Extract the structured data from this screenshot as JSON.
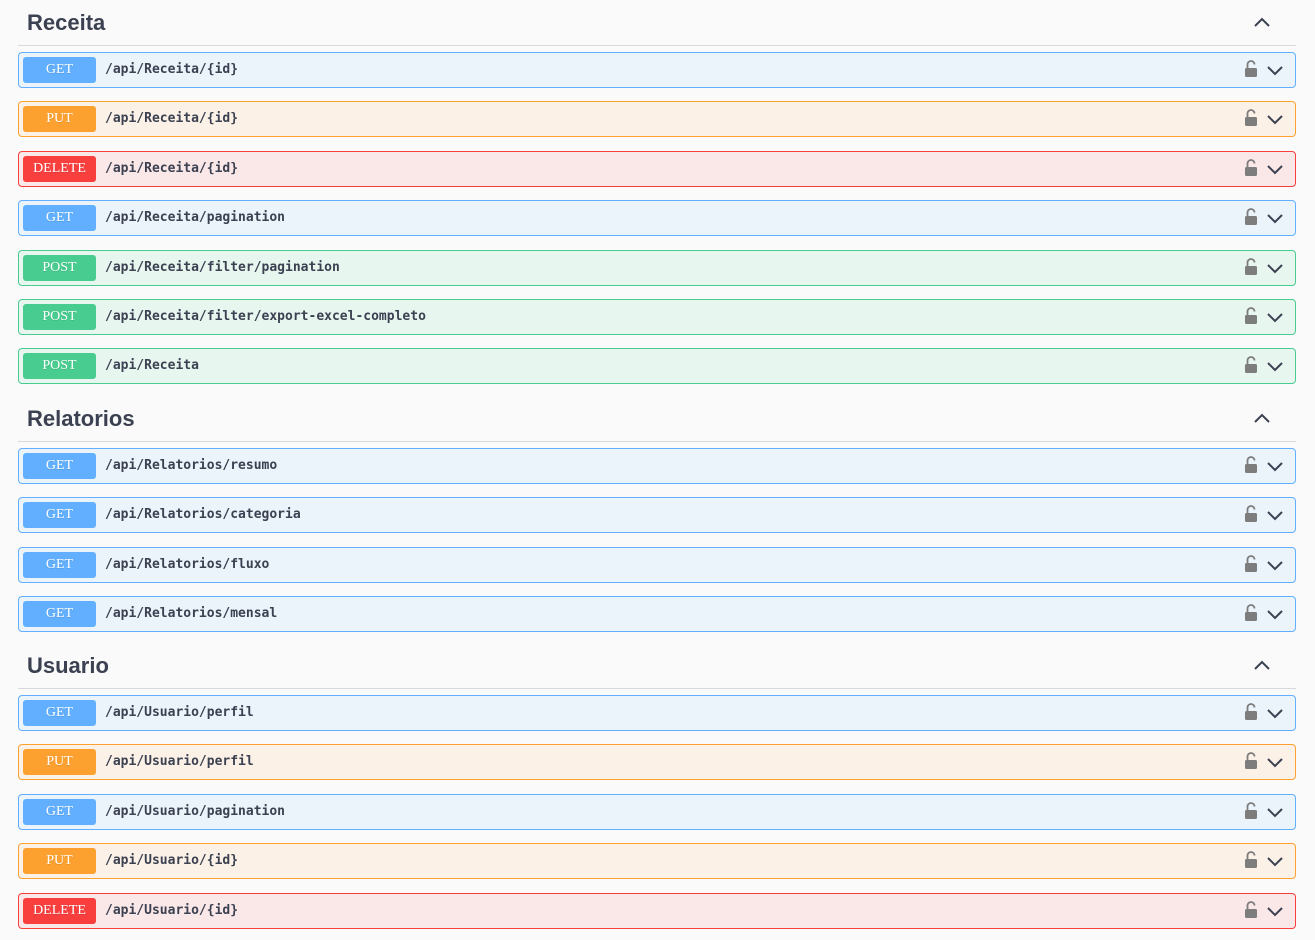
{
  "colors": {
    "get": "#61affe",
    "put": "#fca130",
    "post": "#49cc90",
    "delete": "#f93e3e",
    "text": "#3b4151"
  },
  "sections": [
    {
      "title": "Receita",
      "toggle_icon": "chevron-up-icon",
      "operations": [
        {
          "method": "GET",
          "path": "/api/Receita/{id}"
        },
        {
          "method": "PUT",
          "path": "/api/Receita/{id}"
        },
        {
          "method": "DELETE",
          "path": "/api/Receita/{id}"
        },
        {
          "method": "GET",
          "path": "/api/Receita/pagination"
        },
        {
          "method": "POST",
          "path": "/api/Receita/filter/pagination"
        },
        {
          "method": "POST",
          "path": "/api/Receita/filter/export-excel-completo"
        },
        {
          "method": "POST",
          "path": "/api/Receita"
        }
      ]
    },
    {
      "title": "Relatorios",
      "toggle_icon": "chevron-up-icon",
      "operations": [
        {
          "method": "GET",
          "path": "/api/Relatorios/resumo"
        },
        {
          "method": "GET",
          "path": "/api/Relatorios/categoria"
        },
        {
          "method": "GET",
          "path": "/api/Relatorios/fluxo"
        },
        {
          "method": "GET",
          "path": "/api/Relatorios/mensal"
        }
      ]
    },
    {
      "title": "Usuario",
      "toggle_icon": "chevron-up-icon",
      "operations": [
        {
          "method": "GET",
          "path": "/api/Usuario/perfil"
        },
        {
          "method": "PUT",
          "path": "/api/Usuario/perfil"
        },
        {
          "method": "GET",
          "path": "/api/Usuario/pagination"
        },
        {
          "method": "PUT",
          "path": "/api/Usuario/{id}"
        },
        {
          "method": "DELETE",
          "path": "/api/Usuario/{id}"
        }
      ]
    }
  ],
  "operation_icons": {
    "lock": "unlocked-padlock-icon",
    "expand": "chevron-down-icon"
  }
}
